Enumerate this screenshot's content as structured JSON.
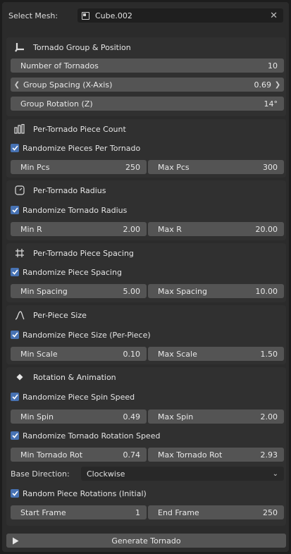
{
  "select_mesh": {
    "label": "Select Mesh:",
    "value": "Cube.002"
  },
  "group": {
    "title": "Tornado Group & Position",
    "num_tornados": {
      "label": "Number of Tornados",
      "value": "10"
    },
    "group_spacing": {
      "label": "Group Spacing (X-Axis)",
      "value": "0.69"
    },
    "group_rotation": {
      "label": "Group Rotation (Z)",
      "value": "14°"
    }
  },
  "piece_count": {
    "title": "Per-Tornado Piece Count",
    "randomize": {
      "label": "Randomize Pieces Per Tornado",
      "checked": true
    },
    "min": {
      "label": "Min Pcs",
      "value": "250"
    },
    "max": {
      "label": "Max Pcs",
      "value": "300"
    }
  },
  "radius": {
    "title": "Per-Tornado Radius",
    "randomize": {
      "label": "Randomize Tornado Radius",
      "checked": true
    },
    "min": {
      "label": "Min R",
      "value": "2.00"
    },
    "max": {
      "label": "Max R",
      "value": "20.00"
    }
  },
  "spacing": {
    "title": "Per-Tornado Piece Spacing",
    "randomize": {
      "label": "Randomize Piece Spacing",
      "checked": true
    },
    "min": {
      "label": "Min Spacing",
      "value": "5.00"
    },
    "max": {
      "label": "Max Spacing",
      "value": "10.00"
    }
  },
  "piece_size": {
    "title": "Per-Piece Size",
    "randomize": {
      "label": "Randomize Piece Size (Per-Piece)",
      "checked": true
    },
    "min": {
      "label": "Min Scale",
      "value": "0.10"
    },
    "max": {
      "label": "Max Scale",
      "value": "1.50"
    }
  },
  "rotation": {
    "title": "Rotation & Animation",
    "spin_random": {
      "label": "Randomize Piece Spin Speed",
      "checked": true
    },
    "min_spin": {
      "label": "Min Spin",
      "value": "0.49"
    },
    "max_spin": {
      "label": "Max Spin",
      "value": "2.00"
    },
    "rot_random": {
      "label": "Randomize Tornado Rotation Speed",
      "checked": true
    },
    "min_rot": {
      "label": "Min Tornado Rot",
      "value": "0.74"
    },
    "max_rot": {
      "label": "Max Tornado Rot",
      "value": "2.93"
    },
    "base_direction": {
      "label": "Base Direction:",
      "value": "Clockwise"
    },
    "random_rotations": {
      "label": "Random Piece Rotations (Initial)",
      "checked": true
    },
    "start_frame": {
      "label": "Start Frame",
      "value": "1"
    },
    "end_frame": {
      "label": "End Frame",
      "value": "250"
    }
  },
  "generate_button": {
    "label": "Generate Tornado"
  },
  "colors": {
    "checkbox": "#4772b3",
    "field": "#545454",
    "panel": "#303030",
    "background": "#1d1d1d"
  },
  "icons": [
    "mesh-cube-icon",
    "clear-x-icon",
    "empty-axes-icon",
    "bars-icon",
    "radius-icon",
    "spacing-grid-icon",
    "curve-icon",
    "diamond-icon",
    "play-icon",
    "checkmark-icon"
  ]
}
